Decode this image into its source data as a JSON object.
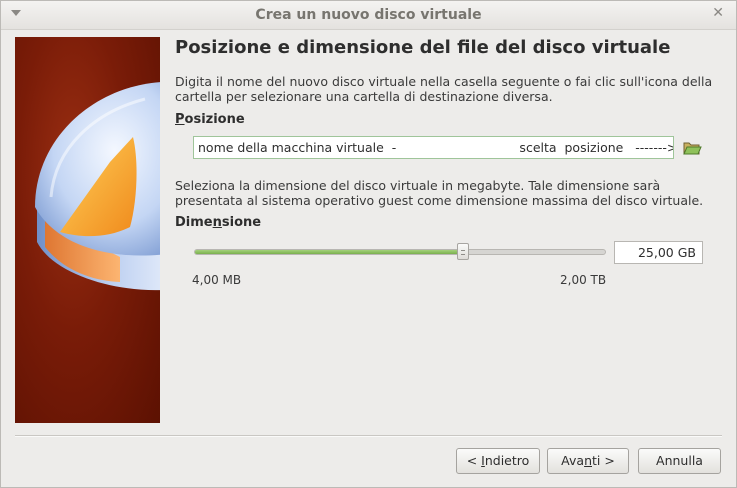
{
  "window": {
    "title": "Crea un nuovo disco virtuale"
  },
  "main": {
    "title": "Posizione e dimensione del file del disco virtuale",
    "location_description": "Digita il nome del nuovo disco virtuale nella casella seguente o fai clic sull'icona della cartella per selezionare una cartella di destinazione diversa.",
    "location_label_mnemonic": "P",
    "location_label_rest": "osizione",
    "location_value": "nome della macchina virtuale  -                               scelta  posizione   ------->",
    "size_description": "Seleziona la dimensione del disco virtuale in megabyte. Tale dimensione sarà presentata al sistema operativo guest come dimensione massima del disco virtuale.",
    "size_label_before": "Dime",
    "size_label_mnemonic": "n",
    "size_label_after": "sione",
    "size_value": "25,00 GB",
    "size_min_label": "4,00 MB",
    "size_max_label": "2,00 TB",
    "slider_fraction": 0.654
  },
  "buttons": {
    "back_prefix": "< ",
    "back_mnemonic": "I",
    "back_rest": "ndietro",
    "next_before": "Ava",
    "next_mnemonic": "n",
    "next_after": "ti >",
    "cancel": "Annulla"
  },
  "icons": {
    "window_menu": "chevron-down-icon",
    "close": "close-icon",
    "folder": "folder-open-icon",
    "wizard_graphic": "pie-chart-disk-graphic"
  },
  "colors": {
    "slider_fill": "#7ab04e",
    "input_focus_border": "#9fc59a",
    "side_background": "#7a1c08"
  }
}
